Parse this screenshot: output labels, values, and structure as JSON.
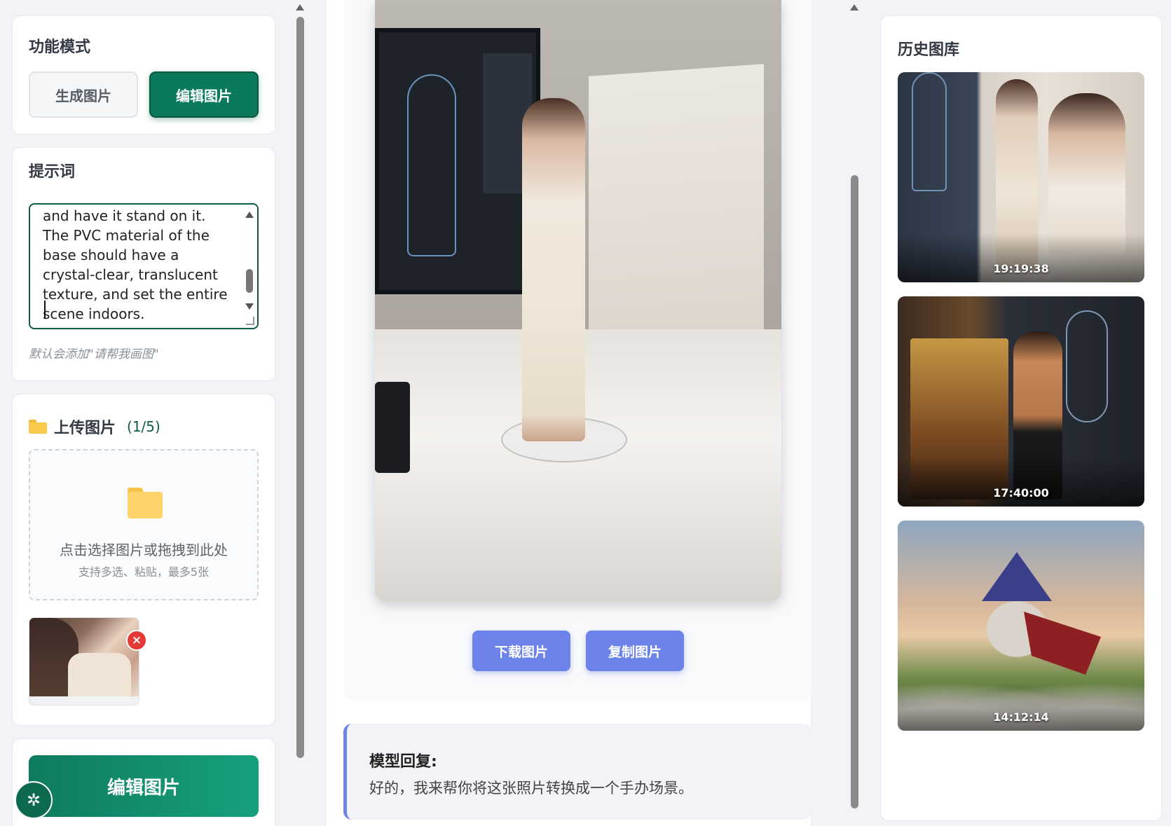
{
  "mode": {
    "title": "功能模式",
    "generate_label": "生成图片",
    "edit_label": "编辑图片",
    "active": "edit"
  },
  "prompt": {
    "title": "提示词",
    "text": "and have it stand on it. The PVC material of the base should have a crystal-clear, translucent texture, and set the entire scene indoors.",
    "hint": "默认会添加\"请帮我画图\""
  },
  "upload": {
    "title": "上传图片",
    "count": "(1/5)",
    "drop_main": "点击选择图片或拖拽到此处",
    "drop_sub": "支持多选、粘贴，最多5张",
    "remove_label": "×"
  },
  "action": {
    "edit_button": "编辑图片"
  },
  "result": {
    "download_label": "下载图片",
    "copy_label": "复制图片"
  },
  "reply": {
    "title": "模型回复:",
    "text": "好的，我来帮你将这张照片转换成一个手办场景。"
  },
  "history": {
    "title": "历史图库",
    "items": [
      {
        "time": "19:19:38"
      },
      {
        "time": "17:40:00"
      },
      {
        "time": "14:12:14"
      }
    ]
  },
  "colors": {
    "accent_green": "#0b7a5c",
    "accent_blue": "#6c83ea",
    "danger": "#e53935"
  }
}
